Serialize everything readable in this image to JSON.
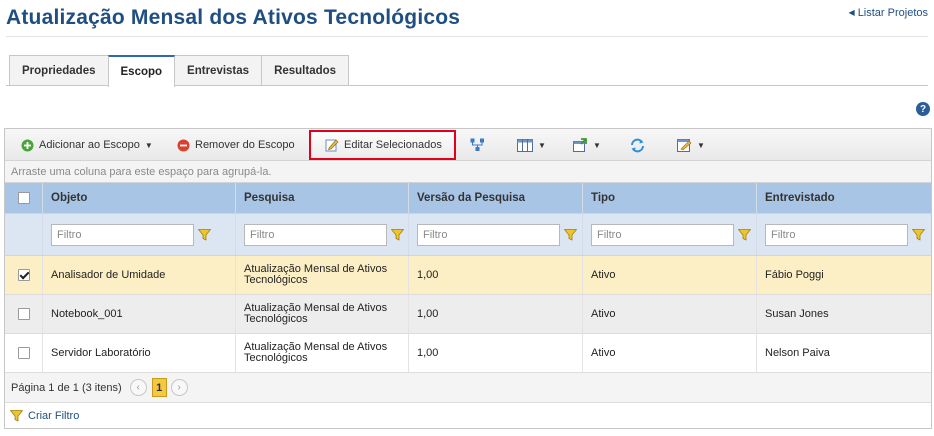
{
  "header": {
    "title": "Atualização Mensal dos Ativos Tecnológicos",
    "back_link": "Listar Projetos"
  },
  "tabs": [
    {
      "label": "Propriedades",
      "active": false
    },
    {
      "label": "Escopo",
      "active": true
    },
    {
      "label": "Entrevistas",
      "active": false
    },
    {
      "label": "Resultados",
      "active": false
    }
  ],
  "help": {
    "glyph": "?"
  },
  "toolbar": {
    "add_label": "Adicionar ao Escopo",
    "remove_label": "Remover do Escopo",
    "edit_label": "Editar Selecionados",
    "icons": [
      "add-circle-icon",
      "remove-circle-icon",
      "edit-icon",
      "hierarchy-icon",
      "columns-icon",
      "export-icon",
      "refresh-icon",
      "report-icon"
    ]
  },
  "grid": {
    "group_hint": "Arraste uma coluna para este espaço para agrupá-la.",
    "columns": [
      "Objeto",
      "Pesquisa",
      "Versão da Pesquisa",
      "Tipo",
      "Entrevistado"
    ],
    "filter_placeholder": "Filtro",
    "rows": [
      {
        "checked": true,
        "objeto": "Analisador de Umidade",
        "pesquisa": "Atualização Mensal de Ativos Tecnológicos",
        "versao": "1,00",
        "tipo": "Ativo",
        "entrevistado": "Fábio Poggi"
      },
      {
        "checked": false,
        "objeto": "Notebook_001",
        "pesquisa": "Atualização Mensal de Ativos Tecnológicos",
        "versao": "1,00",
        "tipo": "Ativo",
        "entrevistado": "Susan Jones"
      },
      {
        "checked": false,
        "objeto": "Servidor Laboratório",
        "pesquisa": "Atualização Mensal de Ativos Tecnológicos",
        "versao": "1,00",
        "tipo": "Ativo",
        "entrevistado": "Nelson Paiva"
      }
    ]
  },
  "pager": {
    "summary": "Página 1 de 1 (3 itens)",
    "current_page": "1",
    "prev_glyph": "‹",
    "next_glyph": "›"
  },
  "footer": {
    "create_filter": "Criar Filtro"
  },
  "colors": {
    "title": "#1f4f82",
    "header_row": "#a8c5e6",
    "filter_row": "#dbe6f2",
    "selected_row": "#fcefc5",
    "highlight_border": "#e3001b",
    "page_active": "#f5c842"
  }
}
